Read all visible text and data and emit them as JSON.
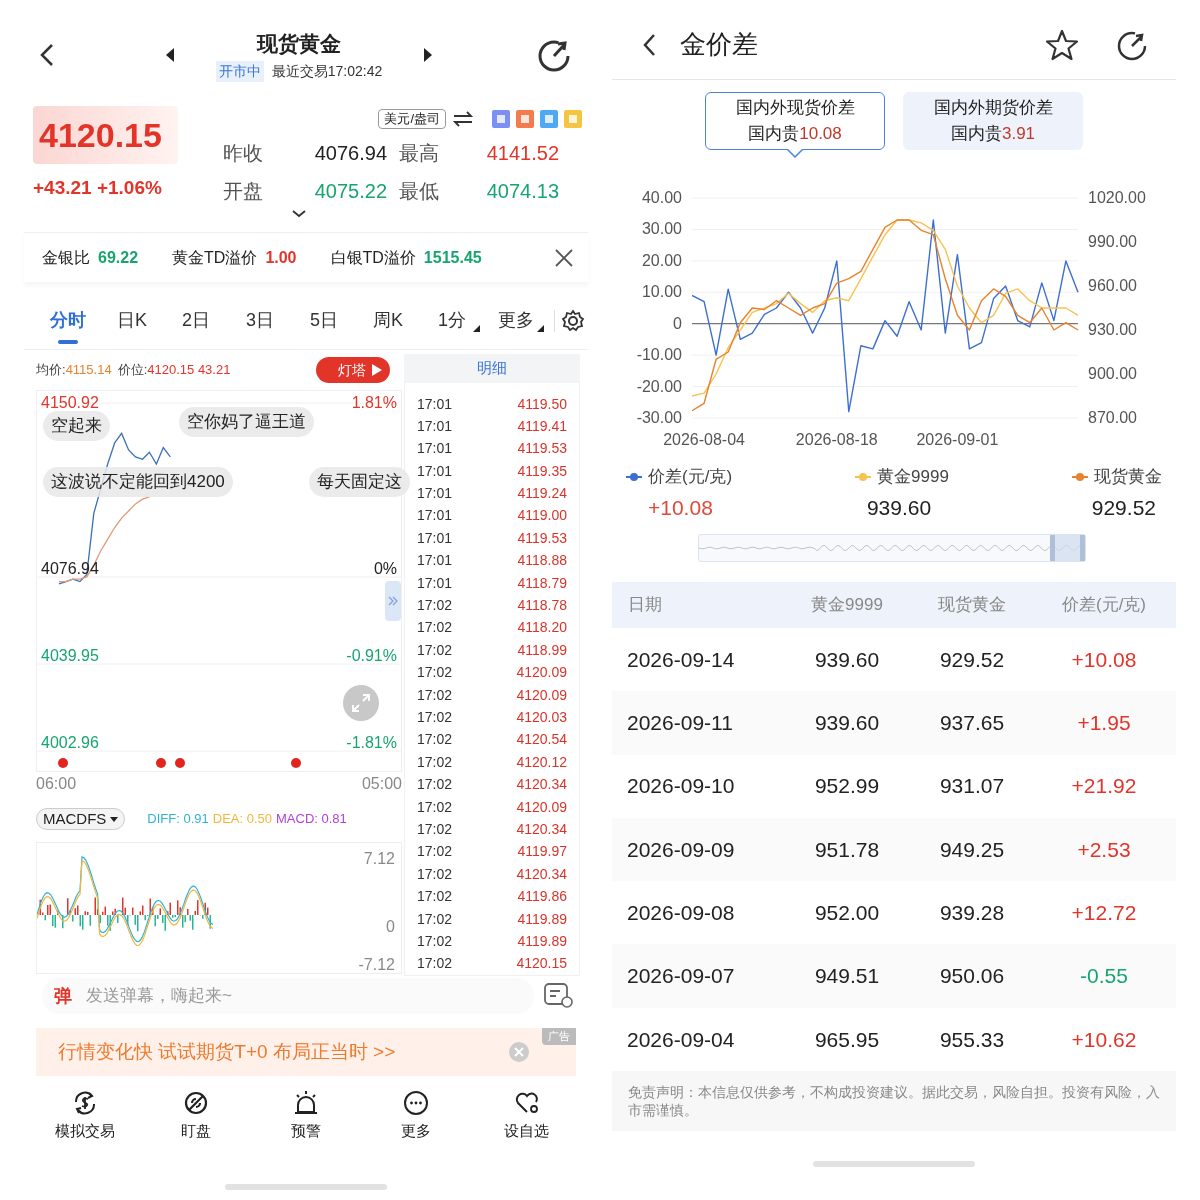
{
  "quote_screen": {
    "title": "现货黄金",
    "market_status": "开市中",
    "last_trade": "最近交易17:02:42",
    "price": "4120.15",
    "change": "+43.21 +1.06%",
    "unit_selector": "美元/盎司",
    "stats": [
      {
        "label": "昨收",
        "value": "4076.94",
        "color": "#222222"
      },
      {
        "label": "最高",
        "value": "4141.52",
        "color": "#e3342a"
      },
      {
        "label": "开盘",
        "value": "4075.22",
        "color": "#17a56f"
      },
      {
        "label": "最低",
        "value": "4074.13",
        "color": "#17a56f"
      }
    ],
    "indicators": [
      {
        "label": "金银比",
        "value": "69.22",
        "color": "#17a56f"
      },
      {
        "label": "黄金TD溢价",
        "value": "1.00",
        "color": "#e3342a"
      },
      {
        "label": "白银TD溢价",
        "value": "1515.45",
        "color": "#17a56f"
      }
    ],
    "tabs": [
      {
        "label": "分时",
        "selected": true,
        "dropdown": false
      },
      {
        "label": "日K",
        "selected": false,
        "dropdown": false
      },
      {
        "label": "2日",
        "selected": false,
        "dropdown": false
      },
      {
        "label": "3日",
        "selected": false,
        "dropdown": false
      },
      {
        "label": "5日",
        "selected": false,
        "dropdown": false
      },
      {
        "label": "周K",
        "selected": false,
        "dropdown": false
      },
      {
        "label": "1分",
        "selected": false,
        "dropdown": true
      },
      {
        "label": "更多",
        "selected": false,
        "dropdown": true
      }
    ],
    "chart_info": {
      "avg_label": "均价:",
      "avg": "4115.14",
      "pos_label": "价位:",
      "pos": "4120.15 43.21"
    },
    "promo_button": "灯塔",
    "intraday_chart": {
      "chart_data": {
        "type": "line",
        "categories": [
          "06:00",
          null,
          null,
          null,
          null,
          null,
          null,
          null,
          null,
          null,
          null,
          null,
          null,
          null,
          null,
          null,
          null,
          null,
          null,
          null,
          null,
          null,
          null,
          null,
          null,
          null,
          null,
          null,
          null,
          null,
          null,
          null,
          null,
          null,
          null,
          null,
          null,
          null,
          null,
          null,
          null,
          null,
          null,
          null,
          null,
          null,
          "05:00"
        ],
        "series": [
          {
            "color": "#3a6fb8",
            "values": [
              4074,
              4075,
              4076,
              4075,
              4078,
              4104,
              null,
              4125,
              4134,
              4138,
              4131,
              4128,
              4127,
              4130,
              4125,
              4132,
              4128,
              null,
              null,
              null,
              null,
              null,
              null,
              null,
              null,
              null,
              null,
              null,
              null,
              null,
              null,
              null,
              null,
              null,
              null,
              null,
              null,
              null,
              null,
              null,
              null,
              null,
              null,
              null,
              null,
              null,
              null
            ]
          },
          {
            "color": "#e09a7a",
            "values": [
              4075,
              4075,
              4076,
              4076,
              4077,
              4082,
              4088,
              4093,
              4098,
              4102,
              4105,
              4108,
              4110,
              4111,
              null,
              null,
              null,
              null,
              null,
              null,
              null,
              null,
              null,
              null,
              null,
              null,
              null,
              null,
              null,
              null,
              null,
              null,
              null,
              null,
              null,
              null,
              null,
              null,
              null,
              null,
              null,
              null,
              null,
              null,
              null,
              null,
              null
            ]
          }
        ],
        "ylim": [
          4002.96,
          4150.92
        ],
        "grid": true,
        "yticks": [
          {
            "value": 4150.92,
            "label": "4150.92"
          },
          {
            "value": 4076.94,
            "label": "4076.94"
          },
          {
            "value": 4039.95,
            "label": "4039.95"
          },
          {
            "value": 4002.96,
            "label": "4002.96"
          }
        ]
      },
      "right_labels": [
        {
          "text": "1.81%",
          "color": "#e3342a"
        },
        {
          "text": "0%",
          "color": "#222222"
        },
        {
          "text": "-0.91%",
          "color": "#17a56f"
        },
        {
          "text": "-1.81%",
          "color": "#17a56f"
        }
      ]
    },
    "danmaku": [
      "空起来",
      "空你妈了逼王道",
      "这波说不定能回到4200",
      "每天固定这"
    ],
    "indicator_selector": "MACDFS",
    "macd": [
      {
        "label": "DIFF:",
        "value": "0.91",
        "color": "#2fb3d6"
      },
      {
        "label": "DEA:",
        "value": "0.50",
        "color": "#f2b63c"
      },
      {
        "label": "MACD:",
        "value": "0.81",
        "color": "#b23fd6"
      }
    ],
    "macd_chart": {
      "labels": [
        "7.12",
        "0",
        "-7.12"
      ]
    },
    "ticks": {
      "title": "明细",
      "rows": [
        {
          "time": "17:01",
          "price": "4119.50"
        },
        {
          "time": "17:01",
          "price": "4119.41"
        },
        {
          "time": "17:01",
          "price": "4119.53"
        },
        {
          "time": "17:01",
          "price": "4119.35"
        },
        {
          "time": "17:01",
          "price": "4119.24"
        },
        {
          "time": "17:01",
          "price": "4119.00"
        },
        {
          "time": "17:01",
          "price": "4119.53"
        },
        {
          "time": "17:01",
          "price": "4118.88"
        },
        {
          "time": "17:01",
          "price": "4118.79"
        },
        {
          "time": "17:02",
          "price": "4118.78"
        },
        {
          "time": "17:02",
          "price": "4118.20"
        },
        {
          "time": "17:02",
          "price": "4118.99"
        },
        {
          "time": "17:02",
          "price": "4120.09"
        },
        {
          "time": "17:02",
          "price": "4120.09"
        },
        {
          "time": "17:02",
          "price": "4120.03"
        },
        {
          "time": "17:02",
          "price": "4120.54"
        },
        {
          "time": "17:02",
          "price": "4120.12"
        },
        {
          "time": "17:02",
          "price": "4120.34"
        },
        {
          "time": "17:02",
          "price": "4120.09"
        },
        {
          "time": "17:02",
          "price": "4120.34"
        },
        {
          "time": "17:02",
          "price": "4119.97"
        },
        {
          "time": "17:02",
          "price": "4120.34"
        },
        {
          "time": "17:02",
          "price": "4119.86"
        },
        {
          "time": "17:02",
          "price": "4119.89"
        },
        {
          "time": "17:02",
          "price": "4119.89"
        },
        {
          "time": "17:02",
          "price": "4120.15"
        }
      ]
    },
    "danmaku_toggle": "弹",
    "comment_input": {
      "placeholder": "发送弹幕，嗨起来~"
    },
    "ad": {
      "text": "行情变化快 试试期货T+0 布局正当时 >>",
      "tag": "广告"
    },
    "bottom_nav": [
      {
        "label": "模拟交易"
      },
      {
        "label": "盯盘"
      },
      {
        "label": "预警"
      },
      {
        "label": "更多"
      },
      {
        "label": "设自选"
      }
    ]
  },
  "spread_screen": {
    "title": "金价差",
    "toggles": [
      {
        "title": "国内外现货价差",
        "prefix": "国内贵",
        "value": "10.08",
        "selected": true
      },
      {
        "title": "国内外期货价差",
        "prefix": "国内贵",
        "value": "3.91",
        "selected": false
      }
    ],
    "chart": {
      "chart_data": {
        "type": "line",
        "categories": [
          null,
          "2026-08-04",
          null,
          null,
          null,
          null,
          null,
          null,
          null,
          null,
          null,
          null,
          "2026-08-18",
          null,
          null,
          null,
          null,
          null,
          null,
          null,
          null,
          null,
          "2026-09-01",
          null,
          null,
          null,
          null,
          null,
          null,
          null,
          null,
          null,
          null
        ],
        "series": [
          {
            "name": "价差(元/克)",
            "color": "#3d6fd0",
            "values": [
              9,
              7,
              -10,
              11,
              -5,
              -3,
              3,
              5,
              10,
              5,
              -3,
              5,
              20,
              -28,
              -7,
              -8,
              1,
              -4,
              7,
              -2,
              33,
              -3,
              22,
              -8,
              -6,
              8,
              12,
              1,
              -1,
              13,
              1,
              20,
              10
            ]
          },
          {
            "name": "黄金9999",
            "color": "#f7c34e",
            "axis": "y2",
            "values": [
              885,
              887,
              900,
              918,
              930,
              942,
              945,
              948,
              955,
              948,
              942,
              950,
              952,
              950,
              965,
              980,
              995,
              1005,
              1005,
              1003,
              998,
              985,
              960,
              945,
              935,
              940,
              955,
              958,
              950,
              945,
              945,
              945,
              940
            ]
          },
          {
            "name": "现货黄金",
            "color": "#e8822e",
            "axis": "y2",
            "values": [
              875,
              880,
              910,
              915,
              935,
              945,
              944,
              950,
              945,
              940,
              945,
              948,
              962,
              965,
              970,
              985,
              1000,
              1005,
              1005,
              998,
              995,
              965,
              940,
              930,
              950,
              958,
              953,
              940,
              935,
              945,
              930,
              935,
              930
            ]
          }
        ],
        "ylim": [
          -30,
          40
        ],
        "y2lim": [
          870,
          1020
        ],
        "grid": true,
        "yticks": [
          {
            "value": 40,
            "label": "40.00"
          },
          {
            "value": 30,
            "label": "30.00"
          },
          {
            "value": 20,
            "label": "20.00"
          },
          {
            "value": 10,
            "label": "10.00"
          },
          {
            "value": 0,
            "label": "0"
          },
          {
            "value": -10,
            "label": "-10.00"
          },
          {
            "value": -20,
            "label": "-20.00"
          },
          {
            "value": -30,
            "label": "-30.00"
          }
        ],
        "y2ticks": [
          {
            "value": 1020,
            "label": "1020.00"
          },
          {
            "value": 990,
            "label": "990.00"
          },
          {
            "value": 960,
            "label": "960.00"
          },
          {
            "value": 930,
            "label": "930.00"
          },
          {
            "value": 900,
            "label": "900.00"
          },
          {
            "value": 870,
            "label": "870.00"
          }
        ]
      }
    },
    "legend_values": [
      {
        "text": "+10.08",
        "color": "#e0493a"
      },
      {
        "text": "939.60",
        "color": "#222222"
      },
      {
        "text": "929.52",
        "color": "#222222"
      }
    ],
    "range_slider": {
      "level": 0.09
    },
    "table": {
      "columns": [
        "日期",
        "黄金9999",
        "现货黄金",
        "价差(元/克)"
      ],
      "rows": [
        {
          "date": "2026-09-14",
          "gold_9999": "939.60",
          "spot_gold": "929.52",
          "spread": "+10.08",
          "color": "#e3342a"
        },
        {
          "date": "2026-09-11",
          "gold_9999": "939.60",
          "spot_gold": "937.65",
          "spread": "+1.95",
          "color": "#e3342a"
        },
        {
          "date": "2026-09-10",
          "gold_9999": "952.99",
          "spot_gold": "931.07",
          "spread": "+21.92",
          "color": "#e3342a"
        },
        {
          "date": "2026-09-09",
          "gold_9999": "951.78",
          "spot_gold": "949.25",
          "spread": "+2.53",
          "color": "#e3342a"
        },
        {
          "date": "2026-09-08",
          "gold_9999": "952.00",
          "spot_gold": "939.28",
          "spread": "+12.72",
          "color": "#e3342a"
        },
        {
          "date": "2026-09-07",
          "gold_9999": "949.51",
          "spot_gold": "950.06",
          "spread": "-0.55",
          "color": "#17a56f"
        },
        {
          "date": "2026-09-04",
          "gold_9999": "965.95",
          "spot_gold": "955.33",
          "spread": "+10.62",
          "color": "#e3342a"
        }
      ]
    },
    "disclaimer": "免责声明：本信息仅供参考，不构成投资建议。据此交易，风险自担。投资有风险，入市需谨慎。"
  }
}
